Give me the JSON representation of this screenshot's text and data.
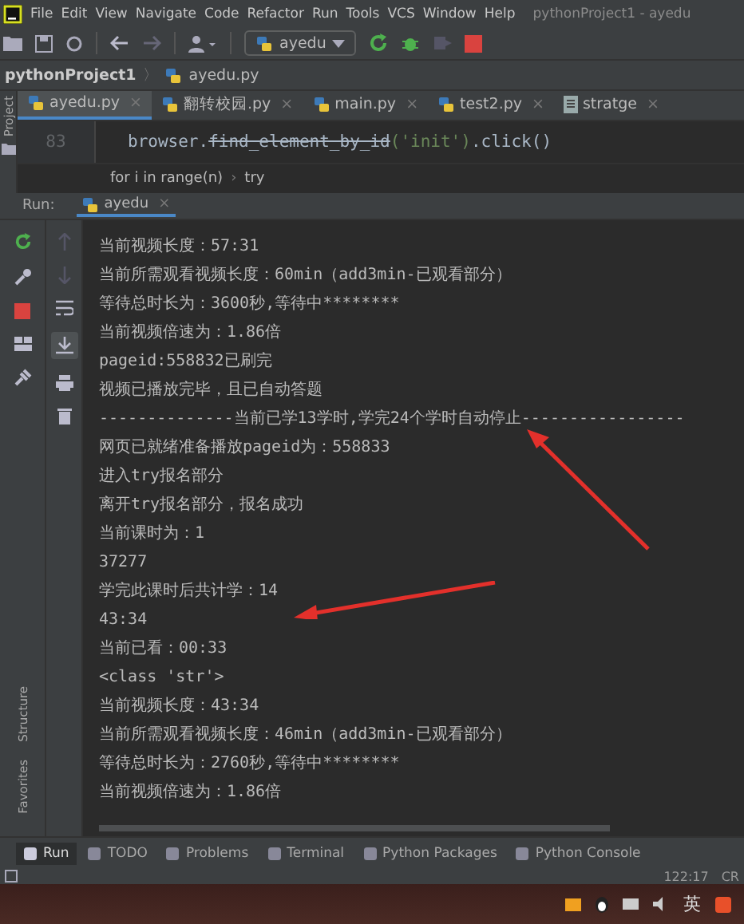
{
  "menu": [
    "File",
    "Edit",
    "View",
    "Navigate",
    "Code",
    "Refactor",
    "Run",
    "Tools",
    "VCS",
    "Window",
    "Help"
  ],
  "window": {
    "title": "pythonProject1 - ayedu"
  },
  "run_config": "ayedu",
  "breadcrumb": {
    "project": "pythonProject1",
    "separator": "〉",
    "file": "ayedu.py"
  },
  "tabs": [
    {
      "label": "ayedu.py",
      "selected": true,
      "kind": "python",
      "close": "×"
    },
    {
      "label": "翻转校园.py",
      "selected": false,
      "kind": "python",
      "close": "×"
    },
    {
      "label": "main.py",
      "selected": false,
      "kind": "python",
      "close": "×"
    },
    {
      "label": "test2.py",
      "selected": false,
      "kind": "python",
      "close": "×"
    },
    {
      "label": "stratge",
      "selected": false,
      "kind": "text",
      "close": "×"
    }
  ],
  "left_strip": [
    "Project"
  ],
  "editor": {
    "line_number": "83",
    "code_prefix": "browser.",
    "code_struck": "find_element_by_id",
    "code_args": "('init')",
    "code_suffix": ".click()"
  },
  "code_path": {
    "items": [
      "for i in range(n)",
      "try"
    ],
    "separator": "›"
  },
  "run_panel": {
    "label": "Run:",
    "tab": "ayedu",
    "close": "×"
  },
  "console_lines": [
    "当前视频长度：57:31",
    "当前所需观看视频长度：60min（add3min-已观看部分）",
    "等待总时长为：3600秒,等待中********",
    "当前视频倍速为：1.86倍",
    "pageid:558832已刷完",
    "视频已播放完毕，且已自动答题",
    "--------------当前已学13学时,学完24个学时自动停止-----------------",
    "网页已就绪准备播放pageid为：558833",
    "进入try报名部分",
    "离开try报名部分，报名成功",
    "当前课时为：1",
    "37277",
    "学完此课时后共计学：14",
    "43:34",
    "当前已看：00:33",
    "<class 'str'>",
    "当前视频长度：43:34",
    "当前所需观看视频长度：46min（add3min-已观看部分）",
    "等待总时长为：2760秒,等待中********",
    "当前视频倍速为：1.86倍"
  ],
  "side_labels": [
    "Structure",
    "Favorites"
  ],
  "tool_tabs": [
    {
      "label": "Run",
      "selected": true
    },
    {
      "label": "TODO",
      "selected": false
    },
    {
      "label": "Problems",
      "selected": false
    },
    {
      "label": "Terminal",
      "selected": false
    },
    {
      "label": "Python Packages",
      "selected": false
    },
    {
      "label": "Python Console",
      "selected": false
    }
  ],
  "status": {
    "position": "122:17",
    "extra": "CR"
  },
  "taskbar": {
    "ime": "英"
  }
}
